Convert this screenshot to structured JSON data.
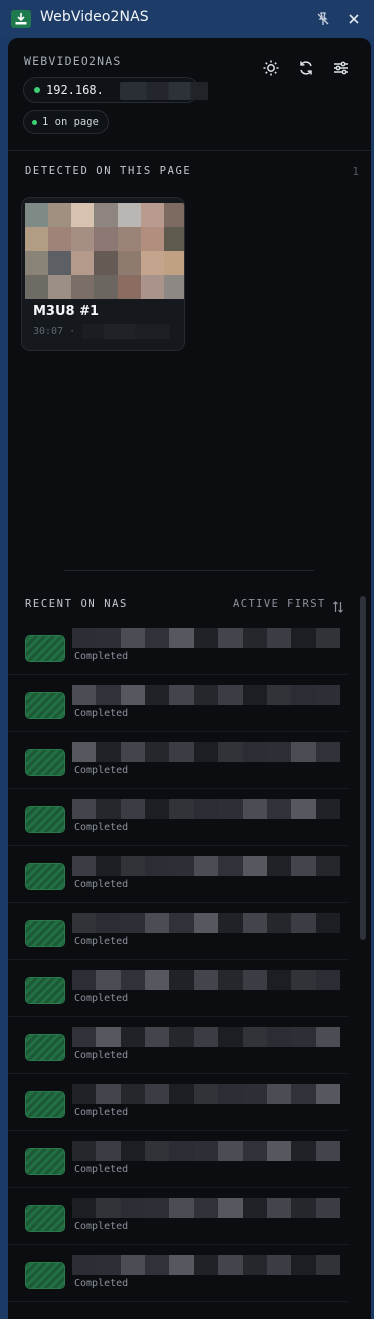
{
  "window": {
    "title": "WebVideo2NAS"
  },
  "header": {
    "brand": "WEBVIDEO2NAS",
    "server_ip_prefix": "192.168.",
    "page_count": "1 on page",
    "status_color": "#3fcf74"
  },
  "detected": {
    "label": "DETECTED ON THIS PAGE",
    "count": "1",
    "items": [
      {
        "title": "M3U8 #1",
        "duration": "30:07 ·"
      }
    ]
  },
  "recent": {
    "label": "RECENT ON NAS",
    "sort_label": "ACTIVE FIRST",
    "items": [
      {
        "status": "Completed"
      },
      {
        "status": "Completed"
      },
      {
        "status": "Completed"
      },
      {
        "status": "Completed"
      },
      {
        "status": "Completed"
      },
      {
        "status": "Completed"
      },
      {
        "status": "Completed"
      },
      {
        "status": "Completed"
      },
      {
        "status": "Completed"
      },
      {
        "status": "Completed"
      },
      {
        "status": "Completed"
      },
      {
        "status": "Completed"
      }
    ]
  }
}
